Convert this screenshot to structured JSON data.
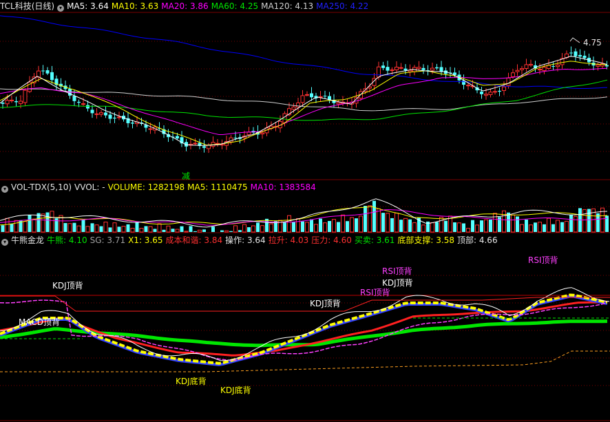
{
  "colors": {
    "up": "#ff3232",
    "down": "#54ffff",
    "ma5": "#ffffff",
    "ma10": "#ffff00",
    "ma20": "#ff00ff",
    "ma60": "#00e600",
    "ma120": "#d0d0d0",
    "ma250": "#0000ff",
    "grid": "#7a0000"
  },
  "price_panel": {
    "title": "TCL科技(日线)",
    "collapse_icon": "chevron-down-icon",
    "ma5": "MA5: 3.64",
    "ma10": "MA10: 3.63",
    "ma20": "MA20: 3.86",
    "ma60": "MA60: 4.25",
    "ma120": "MA120: 4.13",
    "ma250": "MA250: 4.22",
    "high_mark": "4.75",
    "signal": "减"
  },
  "volume_panel": {
    "title": "VOL-TDX(5,10)",
    "vvol": "VVOL: -",
    "volume": "VOLUME: 1282198",
    "ma5": "MA5: 1110475",
    "ma10": "MA10: 1383584"
  },
  "indicator_panel": {
    "title": "牛熊金龙",
    "niu_xiong": "牛熊: 4.10",
    "sg": "SG: 3.71",
    "x1": "X1: 3.65",
    "chengben": "成本和谐: 3.84",
    "caozuo": "操作: 3.64",
    "lasheng": "拉升: 4.03",
    "yali": "压力: 4.60",
    "maimai": "买卖: 3.61",
    "dibu": "底部支撑: 3.58",
    "dingbu": "顶部: 4.66"
  },
  "annotations": [
    {
      "text": "KDJ顶背",
      "color": "#ffffff"
    },
    {
      "text": "MACD顶背",
      "color": "#ffffff"
    },
    {
      "text": "KDJ底背",
      "color": "#ffff00"
    },
    {
      "text": "KDJ底背",
      "color": "#ffff00"
    },
    {
      "text": "KDJ顶背",
      "color": "#ffffff"
    },
    {
      "text": "RSI顶背",
      "color": "#ff40ff"
    },
    {
      "text": "RSI顶背",
      "color": "#ff40ff"
    },
    {
      "text": "KDJ顶背",
      "color": "#ffffff"
    },
    {
      "text": "RSI顶背",
      "color": "#ff40ff"
    }
  ]
}
